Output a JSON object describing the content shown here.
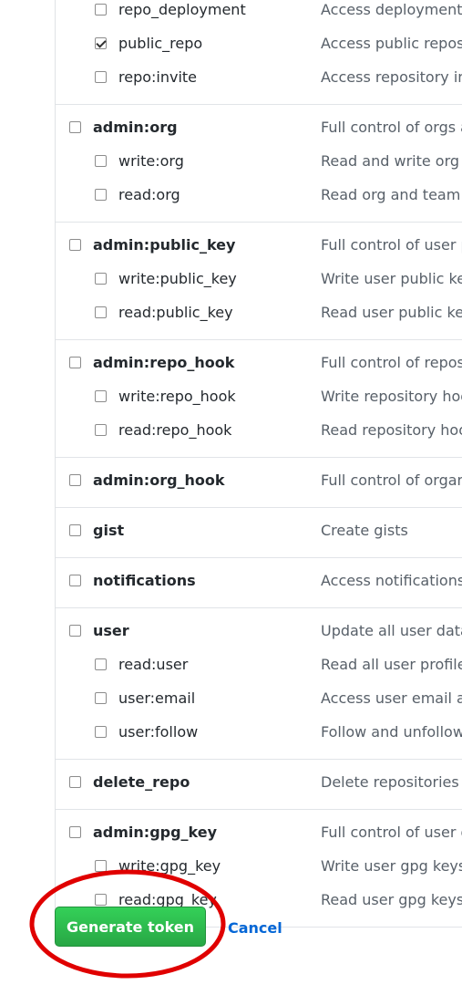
{
  "groups": [
    {
      "parent": null,
      "children": [
        {
          "name": "repo_deployment",
          "desc": "Access deployment status",
          "checked": false
        },
        {
          "name": "public_repo",
          "desc": "Access public repositories",
          "checked": true
        },
        {
          "name": "repo:invite",
          "desc": "Access repository invitations",
          "checked": false
        }
      ]
    },
    {
      "parent": {
        "name": "admin:org",
        "desc": "Full control of orgs and teams",
        "checked": false
      },
      "children": [
        {
          "name": "write:org",
          "desc": "Read and write org and team membership",
          "checked": false
        },
        {
          "name": "read:org",
          "desc": "Read org and team membership",
          "checked": false
        }
      ]
    },
    {
      "parent": {
        "name": "admin:public_key",
        "desc": "Full control of user public keys",
        "checked": false
      },
      "children": [
        {
          "name": "write:public_key",
          "desc": "Write user public keys",
          "checked": false
        },
        {
          "name": "read:public_key",
          "desc": "Read user public keys",
          "checked": false
        }
      ]
    },
    {
      "parent": {
        "name": "admin:repo_hook",
        "desc": "Full control of repository hooks",
        "checked": false
      },
      "children": [
        {
          "name": "write:repo_hook",
          "desc": "Write repository hooks",
          "checked": false
        },
        {
          "name": "read:repo_hook",
          "desc": "Read repository hooks",
          "checked": false
        }
      ]
    },
    {
      "parent": {
        "name": "admin:org_hook",
        "desc": "Full control of organization hooks",
        "checked": false
      },
      "children": []
    },
    {
      "parent": {
        "name": "gist",
        "desc": "Create gists",
        "checked": false
      },
      "children": []
    },
    {
      "parent": {
        "name": "notifications",
        "desc": "Access notifications",
        "checked": false
      },
      "children": []
    },
    {
      "parent": {
        "name": "user",
        "desc": "Update all user data",
        "checked": false
      },
      "children": [
        {
          "name": "read:user",
          "desc": "Read all user profile data",
          "checked": false
        },
        {
          "name": "user:email",
          "desc": "Access user email addresses",
          "checked": false
        },
        {
          "name": "user:follow",
          "desc": "Follow and unfollow users",
          "checked": false
        }
      ]
    },
    {
      "parent": {
        "name": "delete_repo",
        "desc": "Delete repositories",
        "checked": false
      },
      "children": []
    },
    {
      "parent": {
        "name": "admin:gpg_key",
        "desc": "Full control of user gpg keys",
        "checked": false
      },
      "children": [
        {
          "name": "write:gpg_key",
          "desc": "Write user gpg keys",
          "checked": false
        },
        {
          "name": "read:gpg_key",
          "desc": "Read user gpg keys",
          "checked": false
        }
      ]
    }
  ],
  "actions": {
    "generate_label": "Generate token",
    "cancel_label": "Cancel"
  },
  "colors": {
    "primary_green": "#28a745",
    "link_blue": "#0366d6",
    "annotation_red": "#e00000"
  }
}
